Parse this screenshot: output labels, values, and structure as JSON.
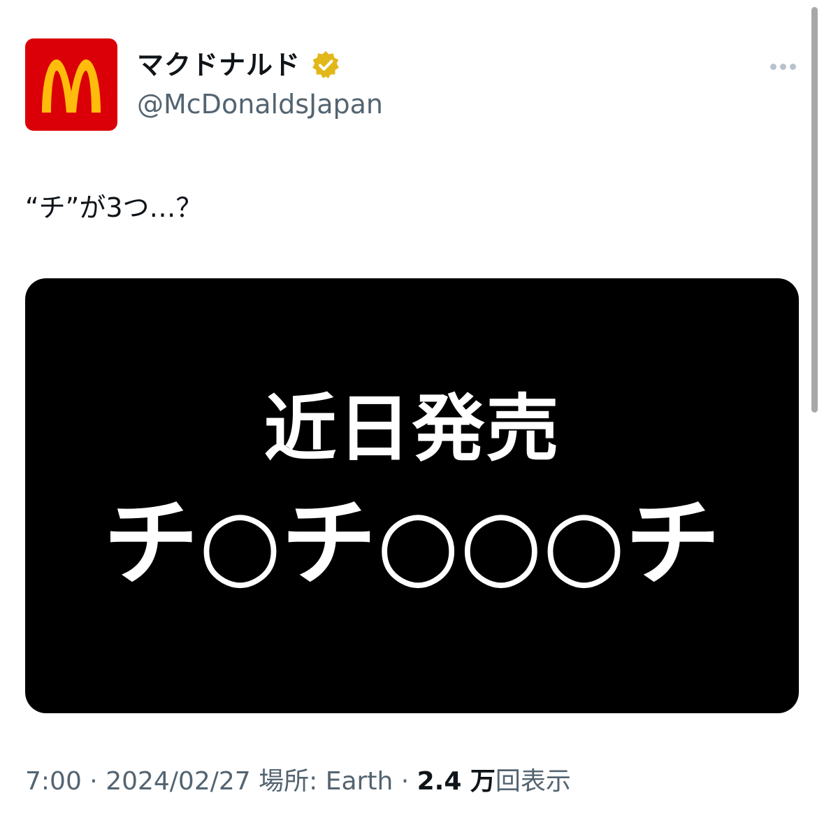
{
  "profile": {
    "display_name": "マクドナルド",
    "handle": "@McDonaldsJapan",
    "avatar_logo": "M",
    "brand_color": "#db0007",
    "logo_color": "#ffbc0d",
    "verified_icon": "gold-verified-badge-icon"
  },
  "more_icon": "ellipsis-icon",
  "tweet": {
    "text": "“チ”が3つ…？"
  },
  "media": {
    "line1": "近日発売",
    "line2": "チ○チ○○○チ"
  },
  "meta": {
    "time": "7:00",
    "sep1": " · ",
    "date": "2024/02/27",
    "location_label": " 場所: ",
    "location": "Earth",
    "sep2": " · ",
    "views_count": "2.4 万",
    "views_label": "回表示"
  }
}
